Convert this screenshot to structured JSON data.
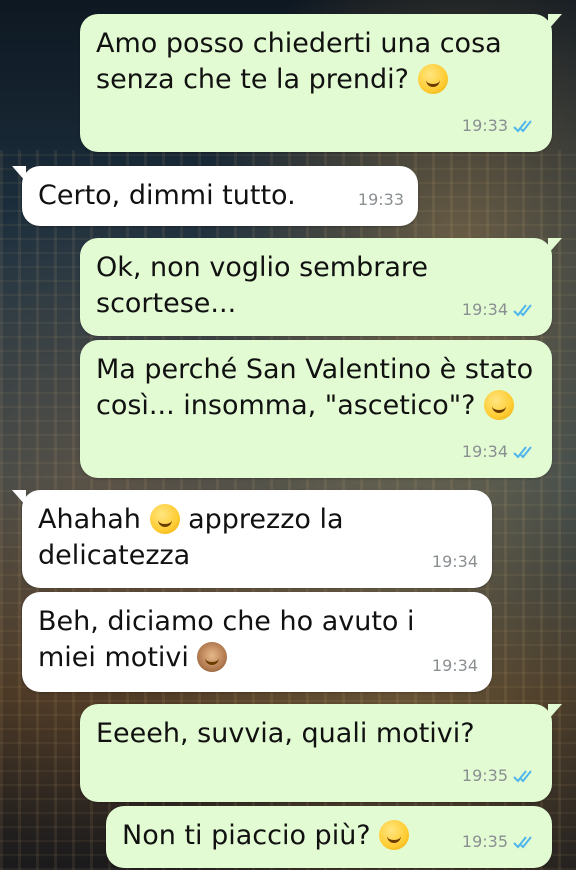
{
  "messages": [
    {
      "direction": "out",
      "text": "Amo posso chiederti una cosa senza che te la prendi?",
      "emoji": "thinking-face",
      "time": "19:33",
      "read": true
    },
    {
      "direction": "in",
      "text": "Certo, dimmi tutto.",
      "time": "19:33"
    },
    {
      "direction": "out",
      "text": "Ok, non voglio sembrare scortese...",
      "time": "19:34",
      "read": true
    },
    {
      "direction": "out",
      "text": "Ma perché San Valentino è stato così... insomma, \"ascetico\"?",
      "emoji": "grinning-sweat-face",
      "time": "19:34",
      "read": true
    },
    {
      "direction": "in",
      "text_before": "Ahahah",
      "emoji": "rolling-laughing-face",
      "text_after": "apprezzo la delicatezza",
      "time": "19:34"
    },
    {
      "direction": "in",
      "text": "Beh, diciamo che ho avuto i miei motivi",
      "emoji": "see-no-evil-monkey",
      "time": "19:34"
    },
    {
      "direction": "out",
      "text": "Eeeeh, suvvia, quali motivi?",
      "time": "19:35",
      "read": true
    },
    {
      "direction": "out",
      "text": "Non ti piaccio più?",
      "emoji": "winking-tongue-face",
      "time": "19:35",
      "read": true
    }
  ],
  "colors": {
    "outgoing_bubble": "#e2fbd3",
    "incoming_bubble": "#ffffff",
    "read_ticks": "#4fb6ec",
    "timestamp": "#8a8f92"
  }
}
